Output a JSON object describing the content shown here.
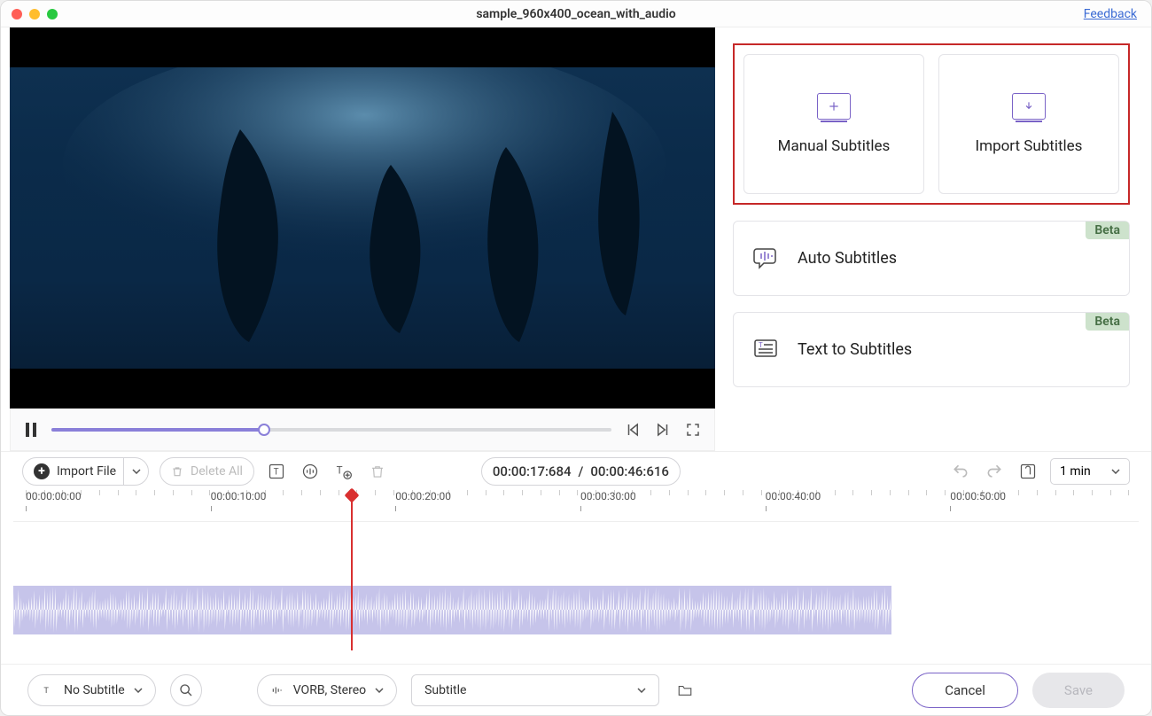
{
  "title": "sample_960x400_ocean_with_audio",
  "feedback": "Feedback",
  "cards": {
    "manual": "Manual Subtitles",
    "import": "Import Subtitles",
    "auto": "Auto Subtitles",
    "text_to": "Text to Subtitles",
    "beta": "Beta"
  },
  "toolbar": {
    "import_file": "Import File",
    "delete_all": "Delete All",
    "current_time": "00:00:17:684",
    "total_time": "00:00:46:616",
    "zoom": "1 min"
  },
  "timeline_ticks": [
    "00:00:00:00",
    "00:00:10:00",
    "00:00:20:00",
    "00:00:30:00",
    "00:00:40:00",
    "00:00:50:00"
  ],
  "bottom": {
    "no_subtitle": "No Subtitle",
    "audio": "VORB, Stereo",
    "subtitle_sel": "Subtitle",
    "cancel": "Cancel",
    "save": "Save"
  }
}
